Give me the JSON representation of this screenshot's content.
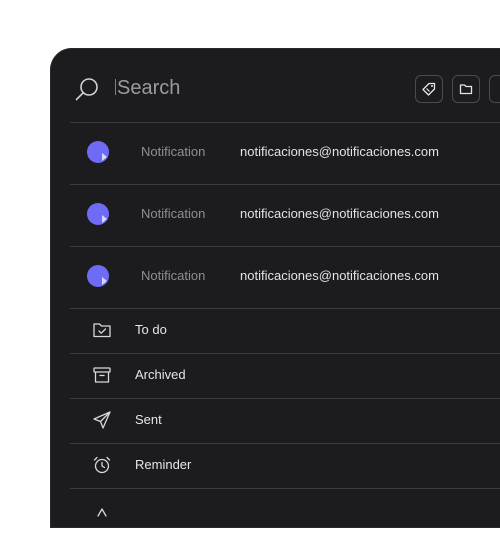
{
  "search": {
    "placeholder": "Search",
    "value": ""
  },
  "toolbar": [
    {
      "icon": "tag-icon"
    },
    {
      "icon": "folder-icon"
    }
  ],
  "notifications": [
    {
      "label": "Notification",
      "email": "notificaciones@notificaciones.com"
    },
    {
      "label": "Notification",
      "email": "notificaciones@notificaciones.com"
    },
    {
      "label": "Notification",
      "email": "notificaciones@notificaciones.com"
    }
  ],
  "folders": [
    {
      "label": "To do",
      "icon": "folder-check-icon"
    },
    {
      "label": "Archived",
      "icon": "archive-icon"
    },
    {
      "label": "Sent",
      "icon": "send-icon"
    },
    {
      "label": "Reminder",
      "icon": "alarm-clock-icon"
    },
    {
      "label": "",
      "icon": "more-icon"
    }
  ],
  "colors": {
    "panel": "#1c1c1e",
    "accent": "#6e6cf7",
    "divider": "#3a3a3f"
  }
}
